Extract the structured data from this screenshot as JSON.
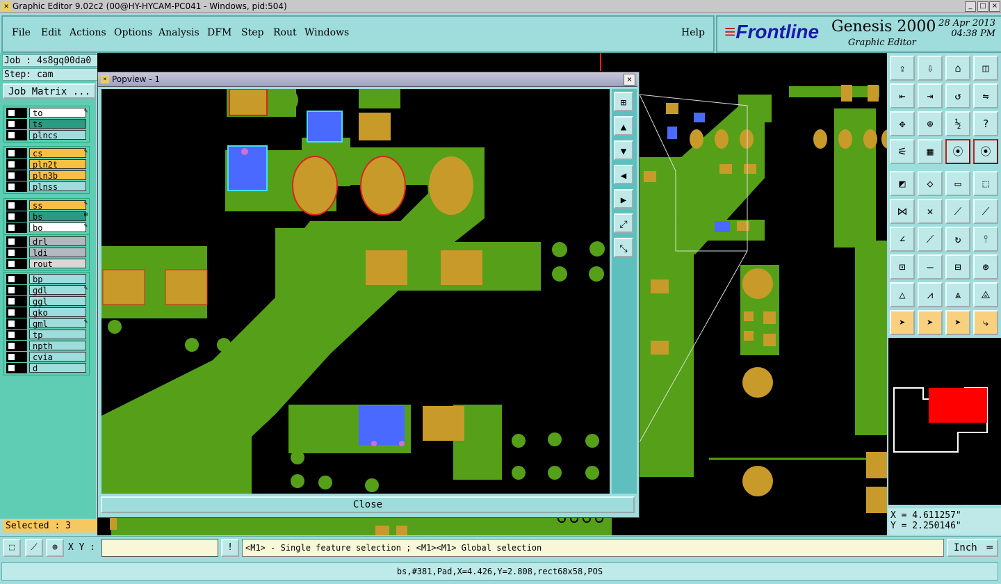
{
  "window": {
    "title": "Graphic Editor 9.02c2 (00@HY-HYCAM-PC041 - Windows, pid:504)",
    "minimize": "_",
    "maximize": "□",
    "close": "×"
  },
  "menu": {
    "items": [
      "File",
      "Edit",
      "Actions",
      "Options",
      "Analysis",
      "DFM",
      "Step",
      "Rout",
      "Windows"
    ],
    "help": "Help"
  },
  "brand": {
    "logo": "Frontline",
    "product": "Genesis 2000",
    "subtitle": "Graphic Editor",
    "date": "28 Apr 2013",
    "time": "04:38 PM"
  },
  "job": {
    "job_label": "Job : 4s8gq00da0",
    "step_label": "Step: cam",
    "matrix_button": "Job Matrix ..."
  },
  "layers": [
    {
      "name": "to",
      "color": "#ffffff",
      "mark": "✎"
    },
    {
      "name": "ts",
      "color": "#2a9a80",
      "mark": ""
    },
    {
      "name": "plncs",
      "color": "#9fdcdc",
      "mark": ""
    },
    {
      "name": "cs",
      "color": "#f8c040",
      "mark": "✎"
    },
    {
      "name": "pln2t",
      "color": "#f8c040",
      "mark": ""
    },
    {
      "name": "pln3b",
      "color": "#f8c040",
      "mark": ""
    },
    {
      "name": "plnss",
      "color": "#9fdcdc",
      "mark": ""
    },
    {
      "name": "ss",
      "color": "#f8c040",
      "mark": "✎"
    },
    {
      "name": "bs",
      "color": "#2a9a80",
      "mark": "⊞"
    },
    {
      "name": "bo",
      "color": "#ffffff",
      "mark": "✎"
    },
    {
      "name": "drl",
      "color": "#b0b8c0",
      "mark": ""
    },
    {
      "name": "ldi",
      "color": "#b0b8c0",
      "mark": ""
    },
    {
      "name": "rout",
      "color": "#d8d8d8",
      "mark": ""
    },
    {
      "name": "bp",
      "color": "#9fdcdc",
      "mark": ""
    },
    {
      "name": "gdl",
      "color": "#9fdcdc",
      "mark": "✎"
    },
    {
      "name": "ggl",
      "color": "#9fdcdc",
      "mark": ""
    },
    {
      "name": "gko",
      "color": "#9fdcdc",
      "mark": ""
    },
    {
      "name": "gml",
      "color": "#9fdcdc",
      "mark": "✎"
    },
    {
      "name": "tp",
      "color": "#9fdcdc",
      "mark": ""
    },
    {
      "name": "npth",
      "color": "#9fdcdc",
      "mark": ""
    },
    {
      "name": "cvia",
      "color": "#9fdcdc",
      "mark": ""
    },
    {
      "name": "d",
      "color": "#9fdcdc",
      "mark": ""
    }
  ],
  "selected": "Selected : 3",
  "popview": {
    "title": "Popview - 1",
    "close_x": "×",
    "close_button": "Close"
  },
  "coords": {
    "x": "X = 4.611257\"",
    "y": "Y = 2.250146\""
  },
  "bottom": {
    "xy_label": "X Y :",
    "xy_value": "",
    "alert_icon": "!",
    "message": "<M1> - Single feature selection ; <M1><M1> Global selection",
    "unit": "Inch"
  },
  "status": "bs,#381,Pad,X=4.426,Y=2.808,rect68x58,POS",
  "toolbox_icons": [
    "layer-up-icon",
    "layer-down-icon",
    "home-icon",
    "split-icon",
    "move-left-icon",
    "move-right-icon",
    "rotate-icon",
    "mirror-icon",
    "zoom-fit-icon",
    "zoom-center-icon",
    "ratio-icon",
    "help-icon",
    "measure-icon",
    "grid-icon",
    "display-icon",
    "display-alt-icon",
    "add-pad-icon",
    "add-line-icon",
    "ruler-icon",
    "snap-icon",
    "connect-icon",
    "cross-icon",
    "point-icon",
    "point-alt-icon",
    "angle-icon",
    "line-icon",
    "arc-icon",
    "text-icon",
    "node-icon",
    "minus-icon",
    "dimension-icon",
    "shape-icon",
    "triangle-icon",
    "triangle-line-icon",
    "triangle-alt-icon",
    "triangle-cross-icon",
    "pointer-icon",
    "pointer-box-icon",
    "pointer-alt-icon",
    "route-icon"
  ],
  "colors": {
    "copper": "#55a018",
    "pad": "#c89a2a",
    "selected_pad": "#4a6aff",
    "background": "#000000",
    "panel": "#9fdcdc"
  }
}
